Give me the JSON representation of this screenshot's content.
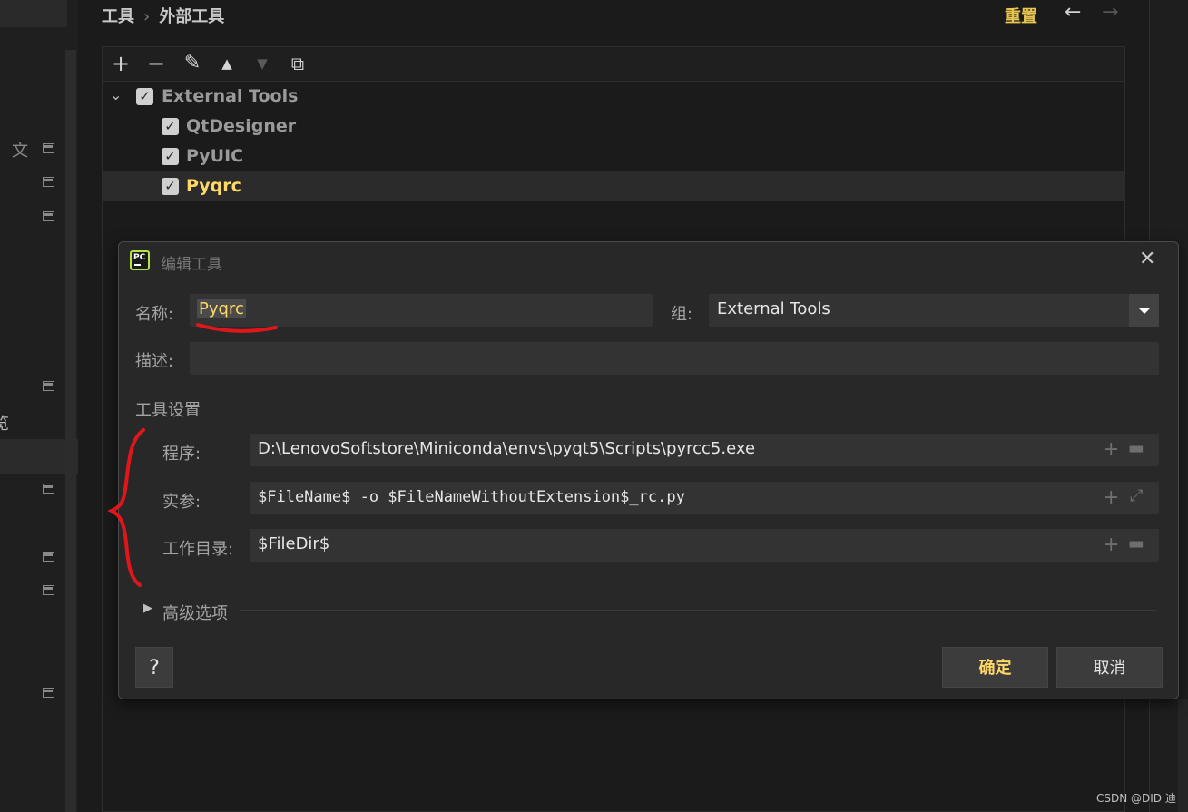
{
  "breadcrumb": {
    "parent": "工具",
    "separator": "›",
    "current": "外部工具"
  },
  "header": {
    "reset_label": "重置",
    "back_icon": "arrow-left-icon",
    "forward_icon": "arrow-right-icon"
  },
  "sidebar": {
    "partial_text": "览",
    "icons": [
      "translate-icon",
      "settings-page-icon"
    ]
  },
  "toolbar": {
    "add": "+",
    "remove": "−",
    "edit": "✎",
    "move_up": "▲",
    "move_down": "▼",
    "copy": "⧉"
  },
  "tree": {
    "group": {
      "label": "External Tools",
      "checked": true,
      "expanded": true
    },
    "items": [
      {
        "label": "QtDesigner",
        "checked": true
      },
      {
        "label": "PyUIC",
        "checked": true
      },
      {
        "label": "Pyqrc",
        "checked": true,
        "selected": true
      }
    ]
  },
  "dialog": {
    "title": "编辑工具",
    "name_label": "名称:",
    "name_value": "Pyqrc",
    "group_label": "组:",
    "group_value": "External Tools",
    "description_label": "描述:",
    "description_value": "",
    "tool_settings_label": "工具设置",
    "program_label": "程序:",
    "program_value": "D:\\LenovoSoftstore\\Miniconda\\envs\\pyqt5\\Scripts\\pyrcc5.exe",
    "arguments_label": "实参:",
    "arguments_value": "$FileName$ -o $FileNameWithoutExtension$_rc.py",
    "workdir_label": "工作目录:",
    "workdir_value": "$FileDir$",
    "advanced_label": "高级选项",
    "help_label": "?",
    "ok_label": "确定",
    "cancel_label": "取消"
  },
  "watermark": "CSDN @DID 迪",
  "colors": {
    "accent": "#ffd866",
    "annotation": "#e0161b",
    "background": "#1b1b1c",
    "dialog": "#282828"
  }
}
